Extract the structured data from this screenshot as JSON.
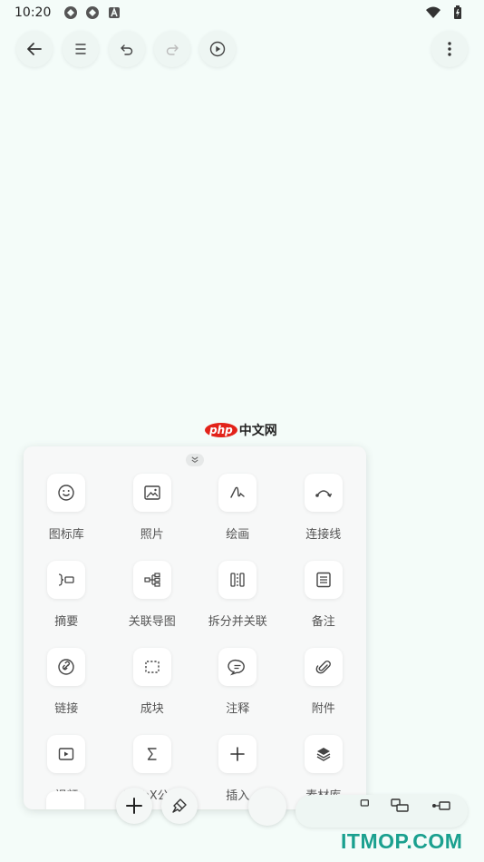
{
  "status_bar": {
    "time": "10:20"
  },
  "toolbar": {
    "back_icon": "arrow-left-icon",
    "outline_icon": "list-icon",
    "undo_icon": "undo-icon",
    "redo_icon": "redo-icon",
    "play_icon": "play-circle-icon",
    "more_icon": "more-vertical-icon"
  },
  "watermark_top": {
    "logo": "php",
    "text": "中文网"
  },
  "insert_panel": {
    "items": [
      {
        "label": "图标库",
        "icon": "emoji-icon"
      },
      {
        "label": "照片",
        "icon": "image-icon"
      },
      {
        "label": "绘画",
        "icon": "pen-draw-icon"
      },
      {
        "label": "连接线",
        "icon": "curve-connector-icon"
      },
      {
        "label": "摘要",
        "icon": "summary-bracket-icon"
      },
      {
        "label": "关联导图",
        "icon": "mindmap-branch-icon"
      },
      {
        "label": "拆分并关联",
        "icon": "split-link-icon"
      },
      {
        "label": "备注",
        "icon": "note-icon"
      },
      {
        "label": "链接",
        "icon": "link-icon"
      },
      {
        "label": "成块",
        "icon": "dashed-block-icon"
      },
      {
        "label": "注释",
        "icon": "comment-icon"
      },
      {
        "label": "附件",
        "icon": "paperclip-icon"
      },
      {
        "label": "视频",
        "icon": "video-icon"
      },
      {
        "label": "LaTeX公式",
        "icon": "sigma-icon"
      },
      {
        "label": "插入",
        "icon": "plus-icon"
      },
      {
        "label": "素材库",
        "icon": "layers-icon"
      }
    ]
  },
  "bottom_bar": {
    "add_icon": "plus-icon",
    "format_icon": "paint-brush-icon"
  },
  "watermark_bottom": {
    "text": "ITMOP.COM"
  },
  "colors": {
    "background": "#f4fcf9",
    "panel": "#f7f8f8",
    "watermark_green": "#1aa08f",
    "php_red": "#e2231a"
  }
}
